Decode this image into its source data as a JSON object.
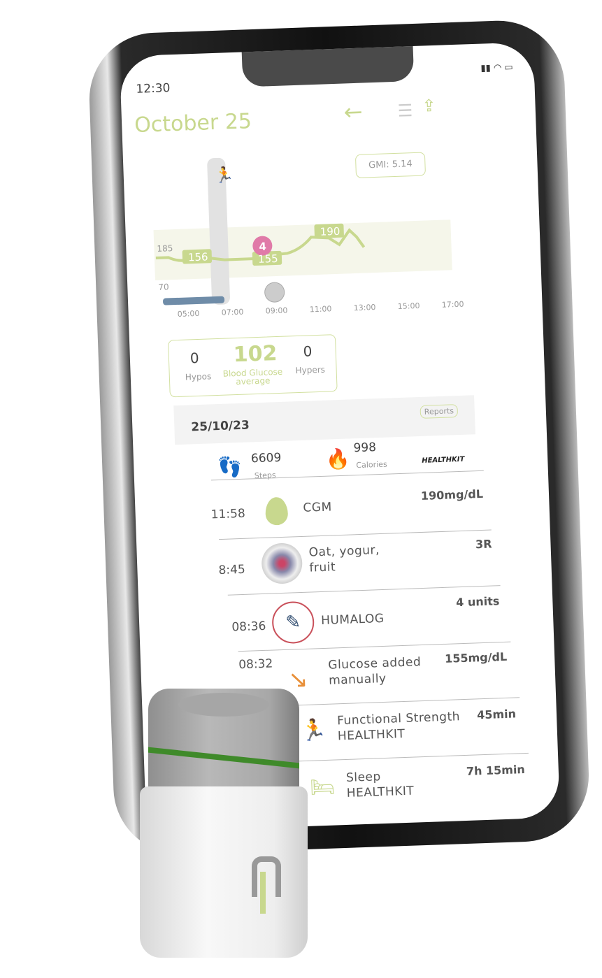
{
  "status_bar": {
    "time": "12:30"
  },
  "header": {
    "title": "October 25",
    "back_icon": "arrow-left-icon",
    "list_icon": "list-icon",
    "share_icon": "share-icon"
  },
  "chart": {
    "gmi_label": "GMI: 5.14",
    "range_high": "185",
    "range_low": "70",
    "point_labels": [
      "156",
      "155",
      "190"
    ],
    "insulin_badge": "4",
    "x_ticks": [
      "05:00",
      "07:00",
      "09:00",
      "11:00",
      "13:00",
      "15:00",
      "17:00"
    ],
    "accent": "#c8d88e",
    "insulin_color": "#e07aa8",
    "sleep_color": "#6f8ca8"
  },
  "summary": {
    "hypos_value": "0",
    "hypos_label": "Hypos",
    "avg_value": "102",
    "avg_label_1": "Blood Glucose",
    "avg_label_2": "average",
    "hypers_value": "0",
    "hypers_label": "Hypers"
  },
  "day": {
    "date": "25/10/23",
    "reports_label": "Reports"
  },
  "healthkit": {
    "steps_value": "6609",
    "steps_label": "Steps",
    "calories_value": "998",
    "calories_label": "Calories",
    "source": "HEALTHKIT"
  },
  "entries": [
    {
      "time": "11:58",
      "title": "CGM",
      "value": "190mg/dL",
      "icon": "drop-icon"
    },
    {
      "time": "8:45",
      "title": "Oat, yogur, fruit",
      "value": "3R",
      "icon": "meal-photo"
    },
    {
      "time": "08:36",
      "title": "HUMALOG",
      "value": "4 units",
      "icon": "insulin-pen-icon"
    },
    {
      "time": "08:32",
      "title": "Glucose added manually",
      "value": "155mg/dL",
      "icon": "arrow-down-right-icon"
    },
    {
      "time": "",
      "title": "Functional Strength HEALTHKIT",
      "value": "45min",
      "icon": "running-icon"
    },
    {
      "time": "",
      "title": "Sleep HEALTHKIT",
      "value": "7h 15min",
      "icon": "sleep-icon"
    }
  ]
}
